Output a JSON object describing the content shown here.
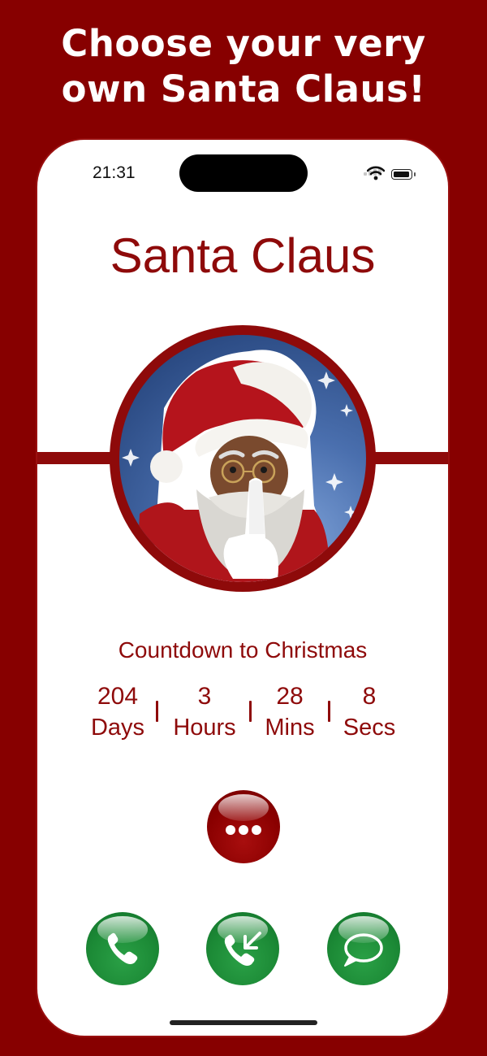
{
  "promo": {
    "line1": "Choose your very",
    "line2": "own Santa Claus!"
  },
  "status_bar": {
    "time": "21:31"
  },
  "screen": {
    "title": "Santa Claus",
    "countdown": {
      "label": "Countdown to Christmas",
      "units": [
        {
          "value": "204",
          "unit": "Days"
        },
        {
          "value": "3",
          "unit": "Hours"
        },
        {
          "value": "28",
          "unit": "Mins"
        },
        {
          "value": "8",
          "unit": "Secs"
        }
      ]
    }
  },
  "icons": {
    "more": "ellipsis-icon",
    "call": "phone-icon",
    "incoming": "incoming-call-icon",
    "message": "message-bubble-icon"
  },
  "colors": {
    "brand_red": "#8e0a0a",
    "background_red": "#870000",
    "call_green": "#1c8a36"
  }
}
